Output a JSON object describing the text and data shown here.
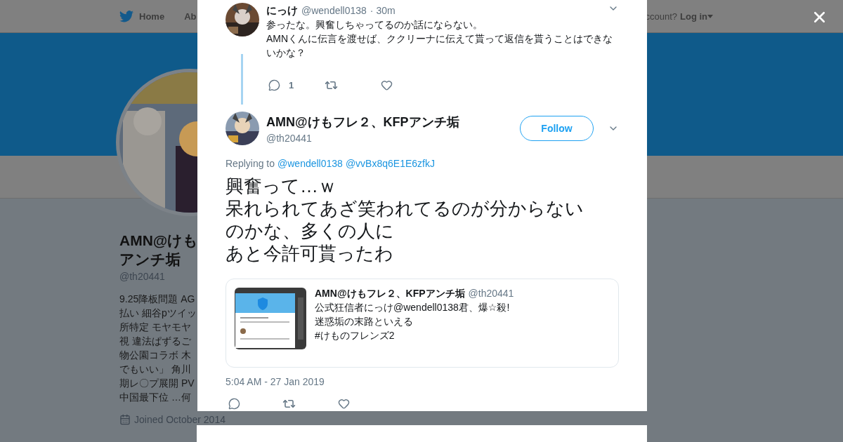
{
  "nav": {
    "items": [
      {
        "label": "Home",
        "kind": "bird"
      },
      {
        "label": "Ab",
        "kind": "plain"
      }
    ],
    "account_prompt": "ccount?",
    "login": "Log in"
  },
  "profile": {
    "name_lines": [
      "AMN@けも",
      "アンチ垢"
    ],
    "handle": "@th20441",
    "bio_lines": [
      "9.25降板問題 AG",
      "払い 細谷pツイッ",
      "所特定 モヤモヤ",
      "視 違法ぱずるご",
      "物公園コラボ 木",
      "でもいい」 角川",
      "期レ〇プ展開 PV",
      "中国最下位 …何"
    ],
    "joined": "Joined October 2014"
  },
  "modal": {
    "parent_tweet": {
      "name": "にっけ",
      "handle": "@wendell0138",
      "time": "· 30m",
      "lines": [
        "参ったな。興奮しちゃってるのか話にならない。",
        "AMNくんに伝言を渡せば、ククリーナに伝えて貰って返信を貰うことはできないかな？"
      ],
      "actions": [
        {
          "kind": "reply",
          "count": "1"
        },
        {
          "kind": "retweet"
        },
        {
          "kind": "like"
        }
      ]
    },
    "tweet": {
      "name": "AMN@けもフレ２、KFPアンチ垢",
      "handle": "@th20441",
      "follow": "Follow",
      "replying_label": "Replying to",
      "replying_to": [
        "@wendell0138",
        "@vvBx8q6E1E6zfkJ"
      ],
      "lines": [
        "興奮って…ｗ",
        "呆れられてあざ笑われてるのが分からないのかな、多くの人に",
        "あと今許可貰ったわ"
      ],
      "quote": {
        "name": "AMN@けもフレ２、KFPアンチ垢",
        "handle": "@th20441",
        "lines": [
          "公式狂信者にっけ@wendell0138君、爆☆殺!",
          "迷惑垢の末路といえる",
          "#けものフレンズ2"
        ]
      },
      "timestamp": "5:04 AM - 27 Jan 2019",
      "actions": [
        {
          "kind": "reply"
        },
        {
          "kind": "retweet"
        },
        {
          "kind": "like"
        }
      ]
    }
  }
}
